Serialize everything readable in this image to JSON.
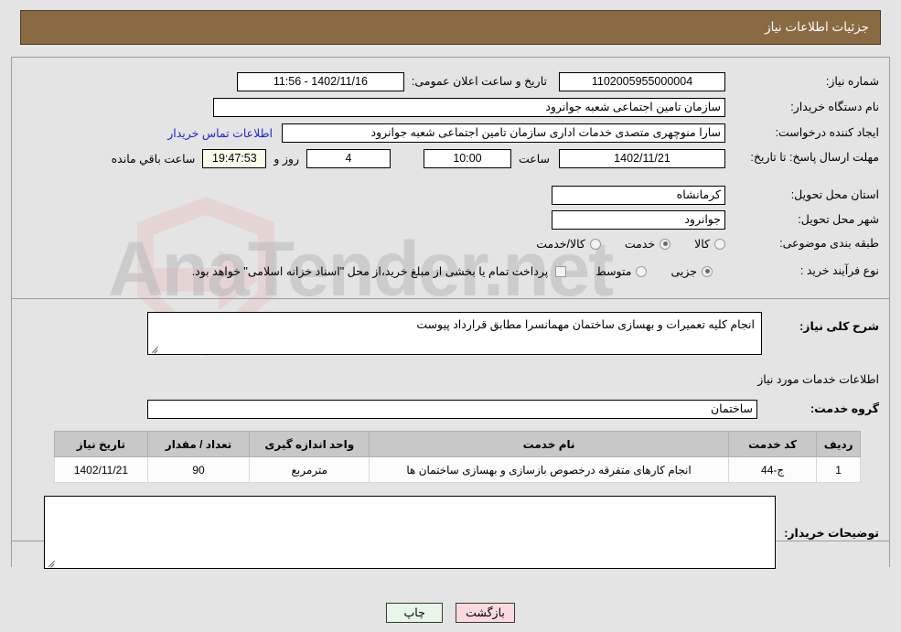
{
  "header": {
    "title": "جزئیات اطلاعات نیاز"
  },
  "top": {
    "need_number_label": "شماره نیاز:",
    "need_number_value": "1102005955000004",
    "public_announce_label": "تاریخ و ساعت اعلان عمومی:",
    "public_announce_value": "1402/11/16 - 11:56",
    "buyer_org_label": "نام دستگاه خریدار:",
    "buyer_org_value": "سازمان تامین اجتماعی شعبه جوانرود",
    "creator_label": "ایجاد کننده درخواست:",
    "creator_value": "سارا منوچهری متصدی خدمات اداری  سازمان تامین اجتماعی شعبه جوانرود",
    "contact_link": "اطلاعات تماس خریدار",
    "deadline_label": "مهلت ارسال پاسخ: تا تاریخ:",
    "deadline_date": "1402/11/21",
    "hour_label": "ساعت",
    "deadline_time": "10:00",
    "days_value": "4",
    "days_label": "روز و",
    "countdown_value": "19:47:53",
    "countdown_label": "ساعت باقي مانده",
    "province_label": "استان محل تحویل:",
    "province_value": "کرمانشاه",
    "city_label": "شهر محل تحویل:",
    "city_value": "جوانرود",
    "category_label": "طبقه بندی موضوعی:",
    "category_options": [
      {
        "label": "کالا",
        "selected": false
      },
      {
        "label": "خدمت",
        "selected": true
      },
      {
        "label": "کالا/خدمت",
        "selected": false
      }
    ],
    "process_label": "نوع فرآیند خرید :",
    "process_options": [
      {
        "label": "جزیی",
        "selected": true
      },
      {
        "label": "متوسط",
        "selected": false
      }
    ],
    "treasury_checkbox_checked": false,
    "treasury_note": "پرداخت تمام یا بخشی از مبلغ خرید،از محل \"اسناد خزانه اسلامی\" خواهد بود."
  },
  "middle": {
    "general_desc_label": "شرح کلی نیاز:",
    "general_desc_value": "انجام کلیه تعمیرات و بهسازی ساختمان مهمانسرا مطابق قرارداد پیوست",
    "services_heading": "اطلاعات خدمات مورد نیاز",
    "service_group_label": "گروه خدمت:",
    "service_group_value": "ساختمان",
    "table": {
      "columns": [
        "ردیف",
        "کد خدمت",
        "نام خدمت",
        "واحد اندازه گیری",
        "تعداد / مقدار",
        "تاریخ نیاز"
      ],
      "rows": [
        {
          "radif": "1",
          "code": "ج-44",
          "name": "انجام کارهای متفرقه درخصوص بازسازی و بهسازی ساختمان ها",
          "unit": "مترمربع",
          "qty": "90",
          "date": "1402/11/21"
        }
      ]
    },
    "buyer_notes_label": "توضیحات خریدار:",
    "buyer_notes_value": ""
  },
  "buttons": {
    "back_label": "بازگشت",
    "print_label": "چاپ"
  },
  "watermark": {
    "text": "AnaTender.net"
  },
  "colors": {
    "header_bg": "#8a6a43",
    "page_bg": "#e4e4e4",
    "link": "#2222cc",
    "back_btn_bg": "#fadadd",
    "print_btn_bg": "#e8f6e8",
    "table_header_bg": "#c8c8c8",
    "countdown_bg": "#fbfbec"
  }
}
